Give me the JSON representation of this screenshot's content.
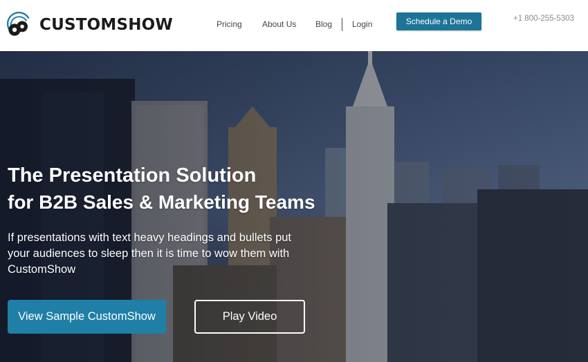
{
  "brand": {
    "name": "CUSTOMSHOW"
  },
  "nav": {
    "items": [
      {
        "label": "Pricing"
      },
      {
        "label": "About Us"
      },
      {
        "label": "Blog"
      },
      {
        "label": "Login"
      }
    ],
    "demo_button": "Schedule a Demo",
    "phone": "+1 800-255-5303"
  },
  "hero": {
    "title": "The Presentation Solution",
    "subtitle": "for B2B Sales & Marketing Teams",
    "body": "If presentations with text heavy headings and bullets put your audiences to sleep then it is time to wow them with CustomShow",
    "primary_button": "View Sample CustomShow",
    "secondary_button": "Play Video",
    "background_image": "city-skyline-photo"
  },
  "colors": {
    "accent": "#1d7497",
    "primary_button": "#1f7fa6",
    "hero_sky": "#3a4b68"
  }
}
